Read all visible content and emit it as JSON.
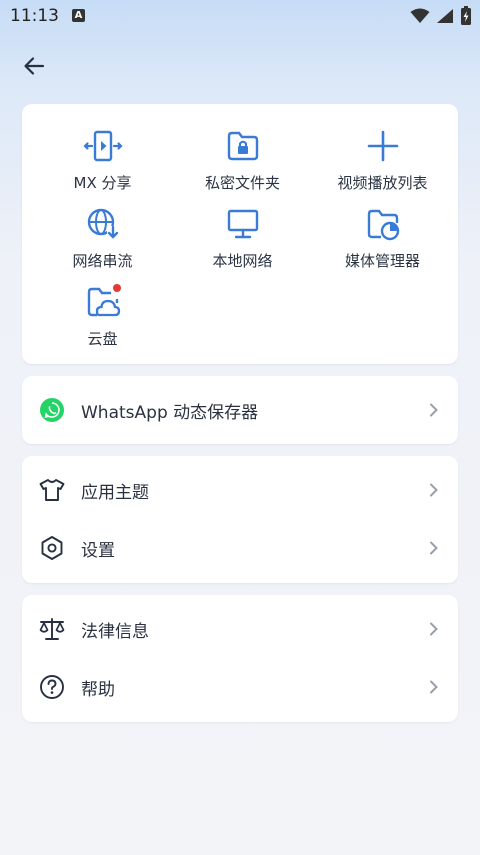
{
  "status": {
    "time": "11:13",
    "badge": "A"
  },
  "colors": {
    "accent": "#3a7bd5",
    "whatsapp": "#25d366",
    "badge_red": "#e53935"
  },
  "grid": [
    {
      "label": "MX 分享",
      "icon": "share-icon"
    },
    {
      "label": "私密文件夹",
      "icon": "private-folder-icon"
    },
    {
      "label": "视频播放列表",
      "icon": "plus-icon"
    },
    {
      "label": "网络串流",
      "icon": "globe-download-icon"
    },
    {
      "label": "本地网络",
      "icon": "monitor-icon"
    },
    {
      "label": "媒体管理器",
      "icon": "folder-chart-icon"
    },
    {
      "label": "云盘",
      "icon": "cloud-folder-icon"
    }
  ],
  "whatsapp": {
    "label": "WhatsApp 动态保存器"
  },
  "menu1": [
    {
      "label": "应用主题",
      "icon": "tshirt-icon"
    },
    {
      "label": "设置",
      "icon": "hexagon-settings-icon"
    }
  ],
  "menu2": [
    {
      "label": "法律信息",
      "icon": "scales-icon"
    },
    {
      "label": "帮助",
      "icon": "help-icon"
    }
  ]
}
